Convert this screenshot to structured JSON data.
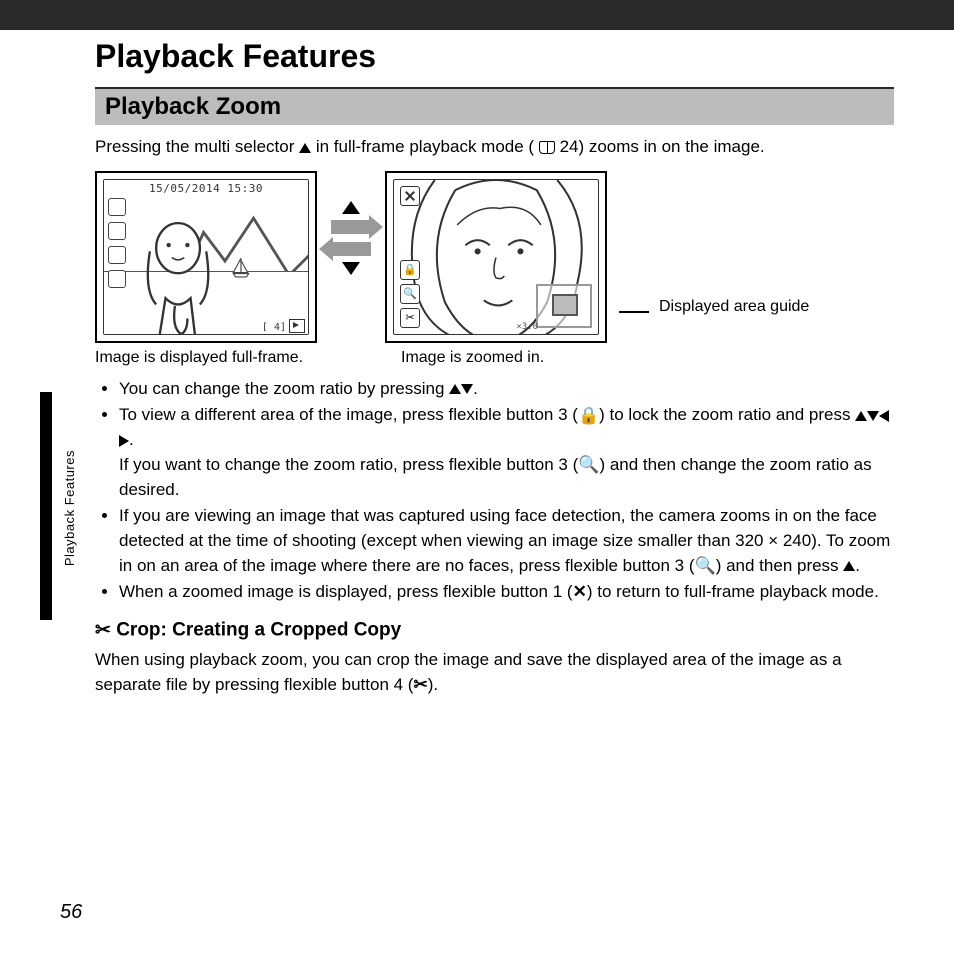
{
  "title": "Playback Features",
  "section": "Playback Zoom",
  "intro": {
    "a": "Pressing the multi selector ",
    "b": " in full-frame playback mode (",
    "c": " 24) zooms in on the image."
  },
  "lcd1": {
    "timestamp": "15/05/2014 15:30",
    "counter": "[    4]",
    "caption": "Image is displayed full-frame."
  },
  "lcd2": {
    "ratio": "×3.0",
    "guide_label": "Displayed area guide",
    "caption": "Image is zoomed in."
  },
  "bullets": [
    {
      "a": "You can change the zoom ratio by pressing ",
      "b": "."
    },
    {
      "a": "To view a different area of the image, press flexible button 3",
      "b": "to lock the zoom ratio and press ",
      "c": ".",
      "d": "If you want to change the zoom ratio, press flexible button 3",
      "e": "and then change the zoom ratio as desired."
    },
    {
      "a": "If you are viewing an image that was captured using face detection, the camera zooms in on the face detected at the time of shooting (except when viewing an image size smaller than 320 × 240). To zoom in on an area of the image where there are no faces, press flexible button 3",
      "b": "and then press ",
      "c": "."
    },
    {
      "a": "When a zoomed image is displayed, press flexible button 1",
      "b": "to return to full-frame playback mode."
    }
  ],
  "crop": {
    "heading": " Crop: Creating a Cropped Copy",
    "a": "When using playback zoom, you can crop the image and save the displayed area of the image as a separate file by pressing flexible button 4",
    "b": "."
  },
  "side_label": "Playback Features",
  "page_number": "56"
}
